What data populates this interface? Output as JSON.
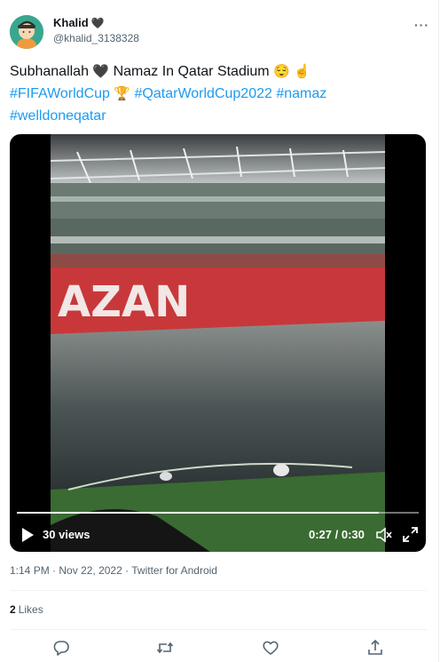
{
  "user": {
    "name": "Khalid",
    "name_emoji": "🖤",
    "handle": "@khalid_3138328"
  },
  "more_icon": "more-horizontal-icon",
  "tweet": {
    "text_line1": "Subhanallah",
    "text_heart": "🖤",
    "text_line1b": "Namaz In Qatar Stadium",
    "text_emoji1": "😌",
    "text_emoji2": "☝️",
    "hashtag1": "#FIFAWorldCup",
    "trophy": "🏆",
    "hashtag2": "#QatarWorldCup2022",
    "hashtag3": "#namaz",
    "hashtag4": "#welldoneqatar"
  },
  "video": {
    "views": "30 views",
    "time": "0:27 / 0:30",
    "progress_fraction": 0.9,
    "stadium_text": "AZAN"
  },
  "meta": {
    "time": "1:14 PM",
    "sep1": "·",
    "date": "Nov 22, 2022",
    "sep2": "·",
    "source": "Twitter for Android"
  },
  "stats": {
    "likes_count": "2",
    "likes_label": "Likes"
  },
  "actions": [
    "reply-icon",
    "retweet-icon",
    "like-icon",
    "share-icon"
  ],
  "colors": {
    "link": "#1d9bf0",
    "secondary": "#536471"
  }
}
